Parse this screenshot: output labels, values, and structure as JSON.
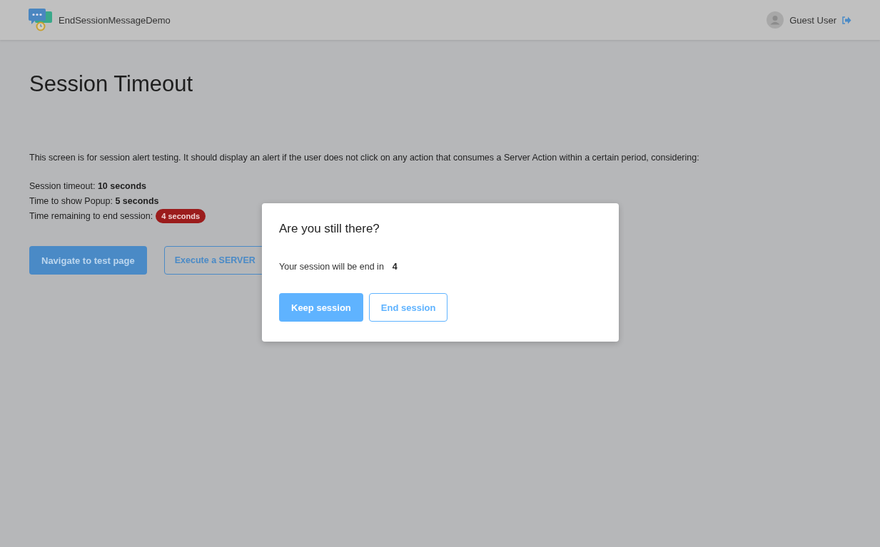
{
  "header": {
    "app_name": "EndSessionMessageDemo",
    "user_name": "Guest User"
  },
  "page": {
    "title": "Session Timeout",
    "description": "This screen is for session alert testing. It should display an alert if the user does not click on any action that consumes a Server Action within a certain period, considering:",
    "settings": [
      {
        "text": "Session timeout: **10 seconds**"
      },
      {
        "text": "Time to show Popup: **5 seconds**"
      },
      {
        "text": "Time remaining to end session:",
        "badge": "4 seconds"
      }
    ],
    "buttons": [
      {
        "label": "Navigate to test page",
        "kind": "primary"
      },
      {
        "label": "Execute a SERVER",
        "kind": "secondary"
      }
    ]
  },
  "dialog": {
    "title": "Are you still there?",
    "message": "Your session will be end in",
    "countdown": "4",
    "buttons": [
      {
        "label": "Keep session",
        "kind": "primary"
      },
      {
        "label": "End session",
        "kind": "secondary"
      }
    ]
  }
}
